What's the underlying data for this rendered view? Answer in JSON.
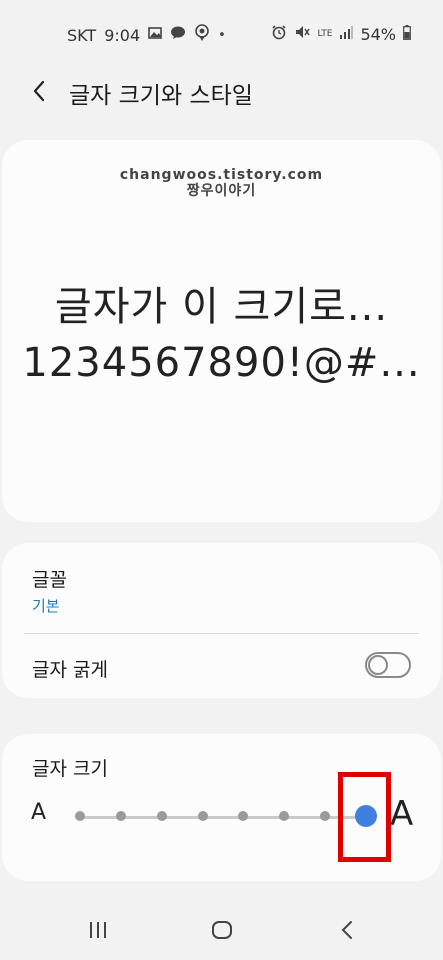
{
  "status_bar": {
    "carrier": "SKT",
    "time": "9:04",
    "network": "LTE",
    "battery": "54%"
  },
  "header": {
    "title": "글자 크기와 스타일"
  },
  "preview": {
    "watermark_line1": "changwoos.tistory.com",
    "watermark_line2": "짱우이야기",
    "line1": "글자가 이 크기로...",
    "line2": "1234567890!@#..."
  },
  "font_settings": {
    "font_label": "글꼴",
    "font_value": "기본",
    "bold_label": "글자 굵게",
    "bold_enabled": false
  },
  "font_size": {
    "label": "글자 크기",
    "small_label": "A",
    "large_label": "A",
    "steps": 8,
    "current_step": 8
  },
  "colors": {
    "accent": "#3f7fe0",
    "link": "#1b7fb8",
    "highlight": "#e00000"
  }
}
